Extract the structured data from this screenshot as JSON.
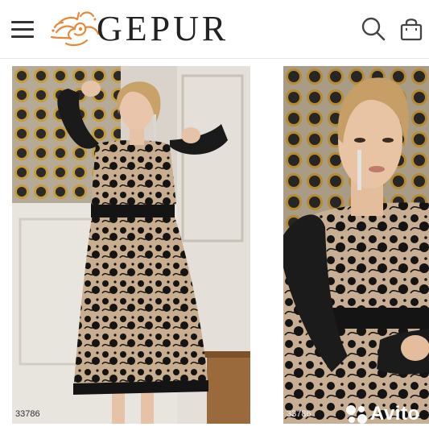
{
  "header": {
    "brand": "GEPUR",
    "menu_icon": "hamburger-menu-icon",
    "search_icon": "search-icon",
    "cart_icon": "shopping-bag-icon"
  },
  "products": [
    {
      "code": "33786"
    },
    {
      "code": "33786"
    }
  ],
  "watermark": {
    "text": "Avito"
  },
  "colors": {
    "logo_accent": "#e8893a",
    "dress_black": "#141414",
    "dress_lining": "#c9ad8f"
  }
}
